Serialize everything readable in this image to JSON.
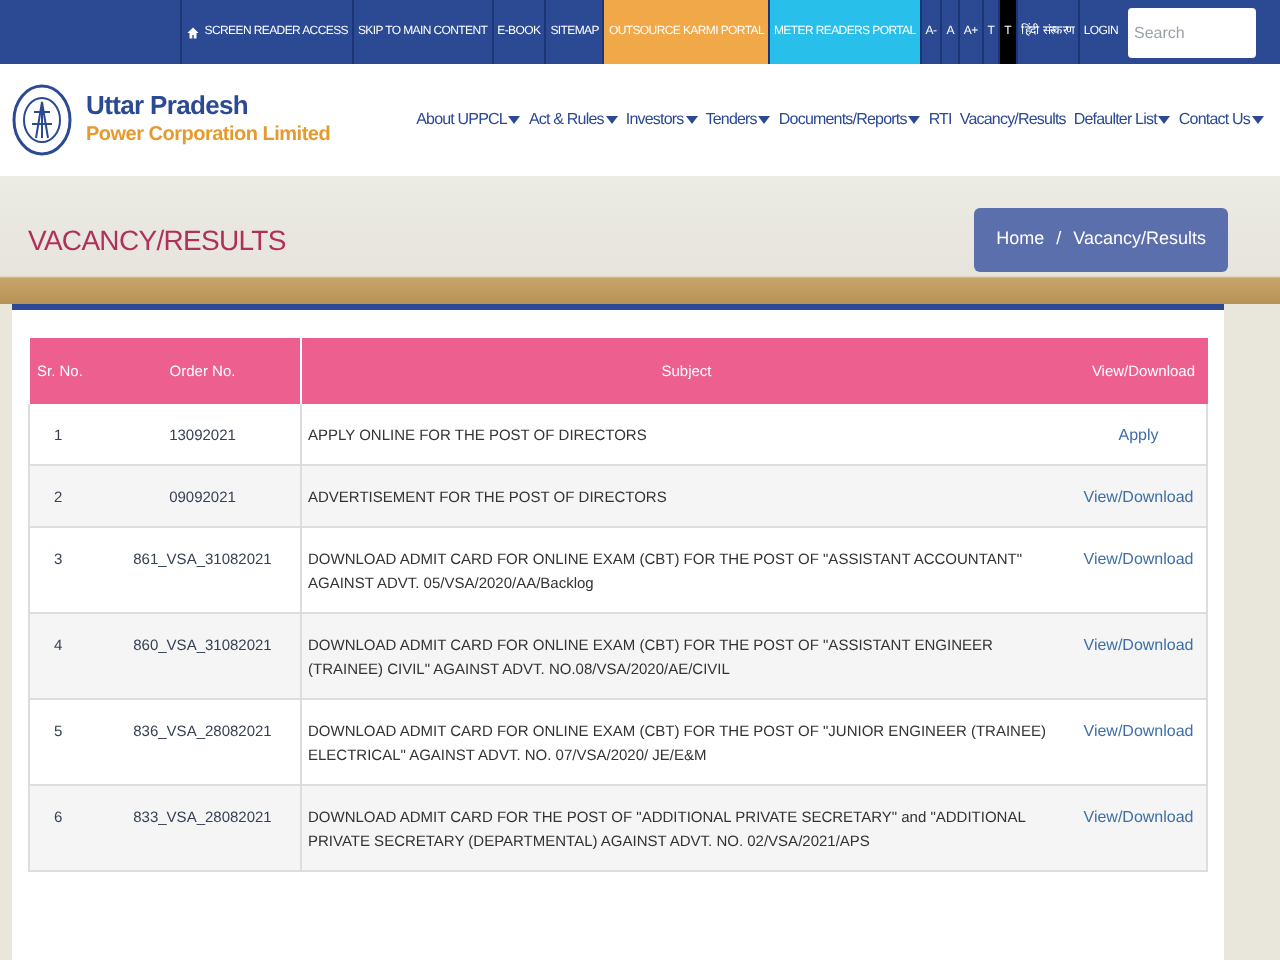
{
  "top_bar": {
    "items": [
      {
        "label": "SCREEN READER ACCESS"
      },
      {
        "label": "SKIP TO MAIN CONTENT"
      },
      {
        "label": "E-BOOK"
      },
      {
        "label": "SITEMAP"
      },
      {
        "label": "OUTSOURCE KARMI PORTAL",
        "color": "#f0a848"
      },
      {
        "label": "METER READERS PORTAL",
        "color": "#28c0ea"
      },
      {
        "label": "A-"
      },
      {
        "label": "A"
      },
      {
        "label": "A+"
      },
      {
        "label": "T"
      },
      {
        "label": "T",
        "color": "#000000"
      },
      {
        "label": "हिंदी संस्करण"
      },
      {
        "label": "LOGIN"
      }
    ],
    "search": {
      "placeholder": "Search"
    }
  },
  "header": {
    "title": "Uttar Pradesh",
    "subtitle": "Power Corporation Limited",
    "nav": [
      {
        "label": "About UPPCL",
        "dropdown": true
      },
      {
        "label": "Act & Rules",
        "dropdown": true
      },
      {
        "label": "Investors",
        "dropdown": true
      },
      {
        "label": "Tenders",
        "dropdown": true
      },
      {
        "label": "Documents/Reports",
        "dropdown": true
      },
      {
        "label": "RTI",
        "dropdown": false
      },
      {
        "label": "Vacancy/Results",
        "dropdown": false
      },
      {
        "label": "Defaulter List",
        "dropdown": true
      },
      {
        "label": "Contact Us",
        "dropdown": true
      }
    ]
  },
  "banner": {
    "title": "VACANCY/RESULTS",
    "breadcrumb": [
      "Home",
      "/",
      "Vacancy/Results"
    ]
  },
  "table": {
    "columns": [
      "Sr. No.",
      "Order No.",
      "Subject",
      "View/Download"
    ],
    "rows": [
      {
        "sr": "1",
        "order": "13092021",
        "subject": "APPLY ONLINE FOR THE POST OF DIRECTORS",
        "action": "Apply"
      },
      {
        "sr": "2",
        "order": "09092021",
        "subject": "ADVERTISEMENT FOR THE POST OF DIRECTORS",
        "action": "View/Download"
      },
      {
        "sr": "3",
        "order": "861_VSA_31082021",
        "subject": "DOWNLOAD ADMIT CARD FOR ONLINE EXAM (CBT)  FOR THE POST OF \"ASSISTANT ACCOUNTANT\" AGAINST ADVT. 05/VSA/2020/AA/Backlog",
        "action": "View/Download"
      },
      {
        "sr": "4",
        "order": "860_VSA_31082021",
        "subject": "DOWNLOAD ADMIT CARD FOR ONLINE EXAM (CBT) FOR THE POST OF \"ASSISTANT ENGINEER (TRAINEE) CIVIL\" AGAINST ADVT.  NO.08/VSA/2020/AE/CIVIL",
        "action": "View/Download"
      },
      {
        "sr": "5",
        "order": "836_VSA_28082021",
        "subject": "DOWNLOAD ADMIT CARD FOR ONLINE EXAM (CBT) FOR THE POST OF \"JUNIOR ENGINEER (TRAINEE) ELECTRICAL\" AGAINST ADVT. NO. 07/VSA/2020/ JE/E&M",
        "action": "View/Download"
      },
      {
        "sr": "6",
        "order": "833_VSA_28082021",
        "subject": "DOWNLOAD ADMIT CARD FOR THE POST OF \"ADDITIONAL PRIVATE SECRETARY\" and \"ADDITIONAL PRIVATE SECRETARY (DEPARTMENTAL) AGAINST ADVT. NO. 02/VSA/2021/APS",
        "action": "View/Download"
      }
    ]
  }
}
